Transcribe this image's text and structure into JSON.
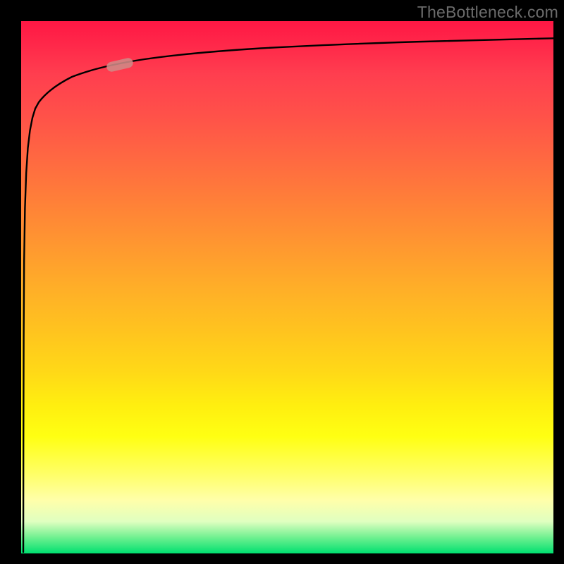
{
  "watermark": "TheBottleneck.com",
  "chart_data": {
    "type": "line",
    "title": "",
    "xlabel": "",
    "ylabel": "",
    "xlim": [
      0,
      100
    ],
    "ylim": [
      0,
      100
    ],
    "note": "No numeric axis ticks or labels are visible; values below are pixel-approximate positions of the plotted black curve within the gradient box, in percent of each axis.",
    "series": [
      {
        "name": "curve",
        "x": [
          0.5,
          0.55,
          0.6,
          0.7,
          0.9,
          1.1,
          1.3,
          1.6,
          2.0,
          2.5,
          3.0,
          4.0,
          6.0,
          9.0,
          12.0,
          17.0,
          24.0,
          33.0,
          45.0,
          60.0,
          80.0,
          100.0
        ],
        "y": [
          0,
          20,
          40,
          55,
          65,
          70,
          74,
          77,
          79,
          81,
          82.5,
          84.5,
          86.8,
          88.6,
          89.7,
          90.7,
          91.6,
          92.4,
          93.1,
          93.8,
          94.6,
          95.3
        ]
      }
    ],
    "highlight_marker": {
      "approx_x_pct": 18,
      "approx_y_pct": 90.8,
      "color": "#d48888"
    },
    "background_gradient": {
      "direction": "top-to-bottom",
      "stops": [
        {
          "pct": 0,
          "color": "#ff1744"
        },
        {
          "pct": 50,
          "color": "#ffae28"
        },
        {
          "pct": 78,
          "color": "#ffff12"
        },
        {
          "pct": 100,
          "color": "#00e070"
        }
      ]
    }
  }
}
